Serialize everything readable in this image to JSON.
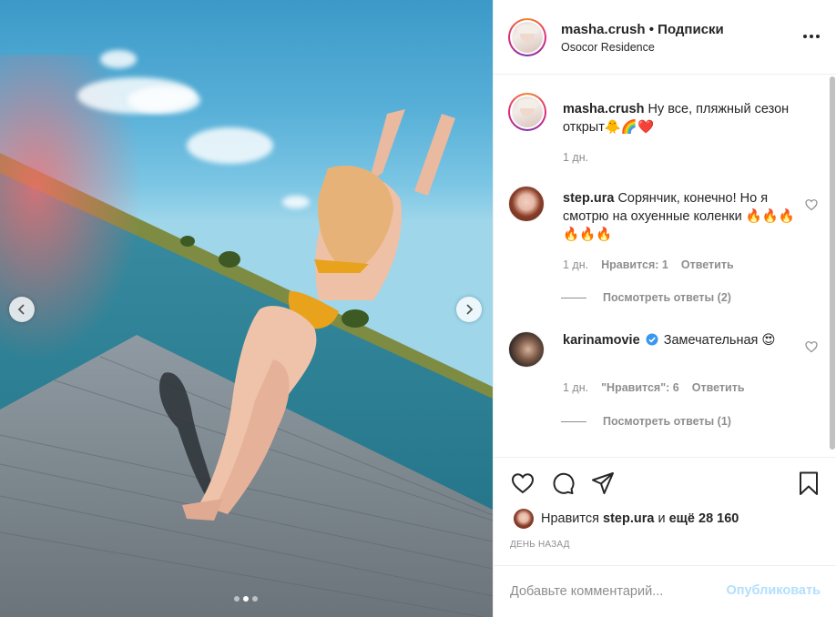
{
  "post": {
    "author": "masha.crush",
    "separator": "•",
    "follow_label": "Подписки",
    "location": "Osocor Residence",
    "more_icon": "more-horizontal-icon",
    "caption_user": "masha.crush",
    "caption_text": "Ну все, пляжный сезон открыт🐥🌈❤️",
    "caption_time": "1 дн."
  },
  "carousel": {
    "prev_icon": "chevron-left-icon",
    "next_icon": "chevron-right-icon",
    "slide_count": 3,
    "active_index": 1
  },
  "comments": [
    {
      "user": "step.ura",
      "text": "Сорянчик, конечно! Но я смотрю на охуенные коленки 🔥🔥🔥🔥🔥🔥",
      "time": "1 дн.",
      "likes": "Нравится: 1",
      "reply_label": "Ответить",
      "view_replies": "Посмотреть ответы (2)"
    },
    {
      "user": "karinamovie",
      "verified": true,
      "text": "Замечательная 😍",
      "time": "1 дн.",
      "likes": "\"Нравится\": 6",
      "reply_label": "Ответить",
      "view_replies": "Посмотреть ответы (1)"
    }
  ],
  "likes_bar": {
    "prefix": "Нравится",
    "user": "step.ura",
    "middle": "и",
    "count": "ещё 28 160"
  },
  "date_label": "ДЕНЬ НАЗАД",
  "comment_input": {
    "placeholder": "Добавьте комментарий...",
    "value": "",
    "publish_label": "Опубликовать"
  },
  "colors": {
    "text": "#262626",
    "secondary": "#8e8e8e",
    "publish_disabled": "#b2dffc",
    "verified": "#3897f0"
  }
}
